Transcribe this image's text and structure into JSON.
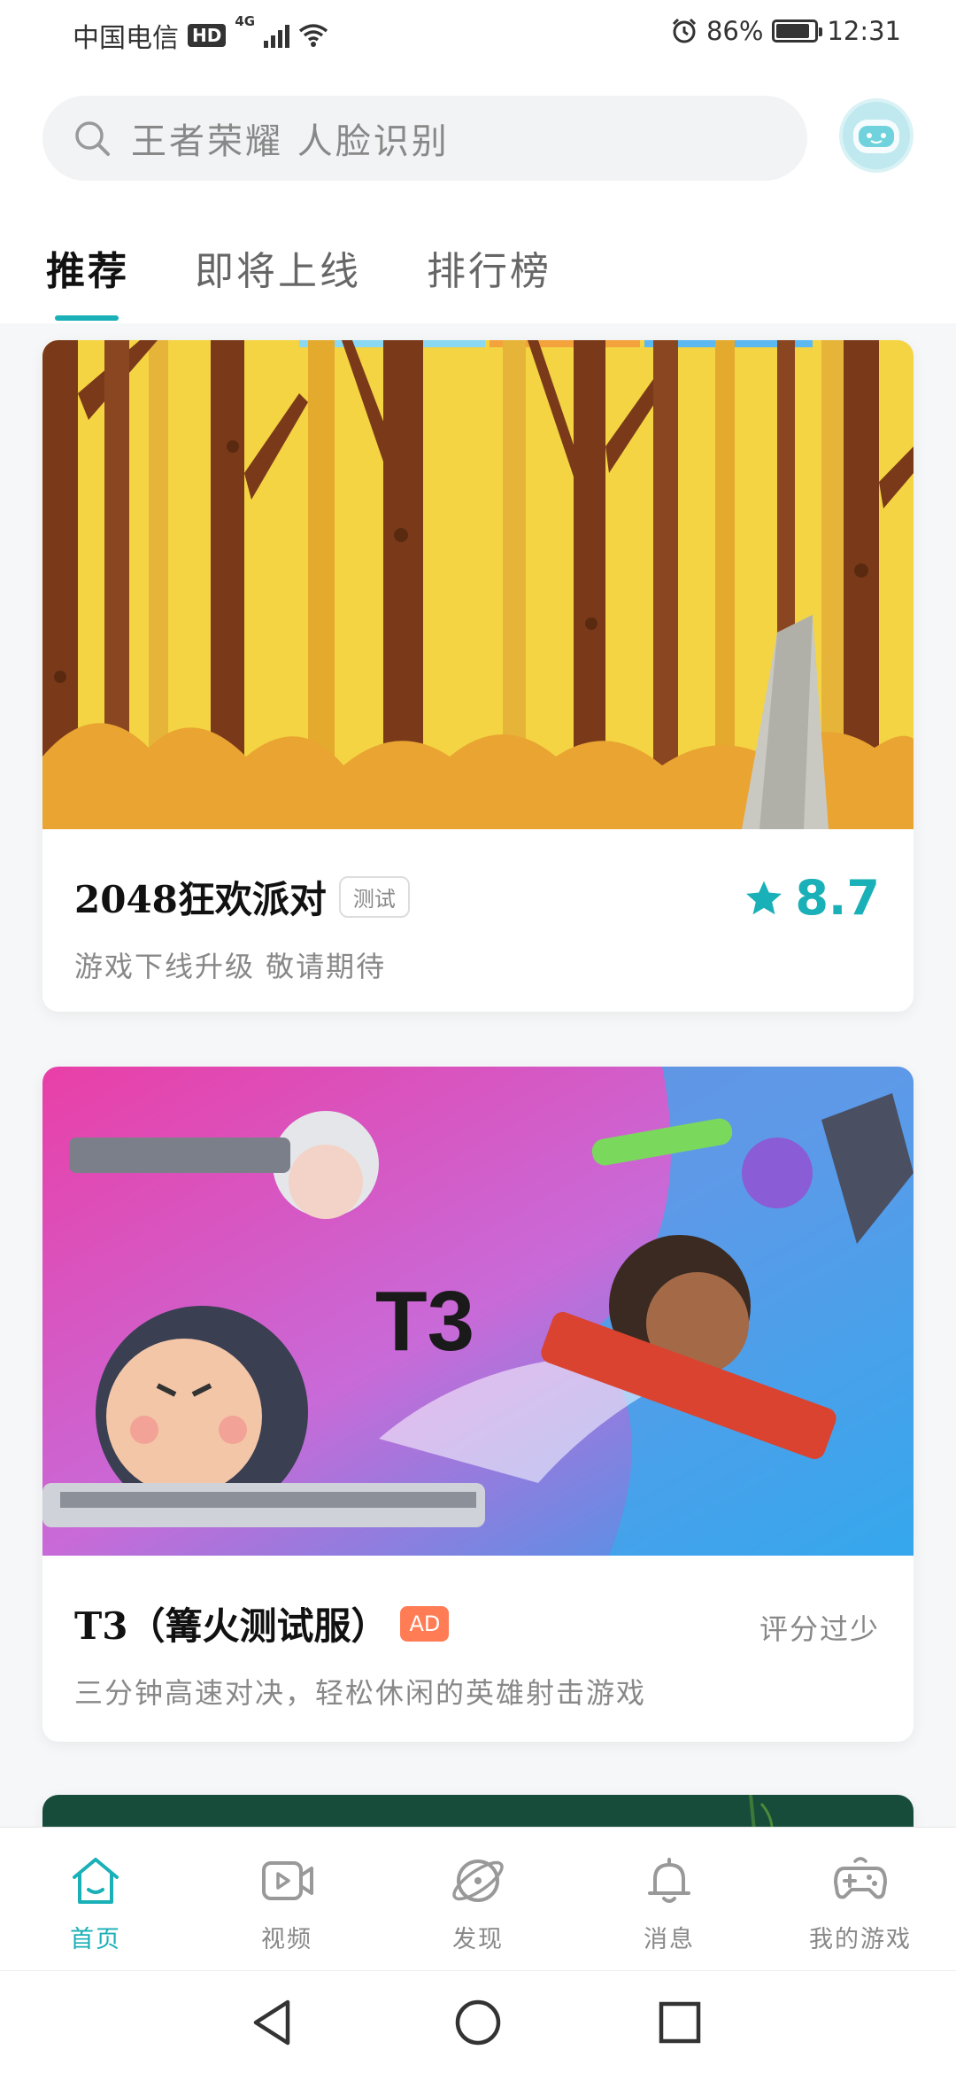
{
  "status_bar": {
    "carrier": "中国电信",
    "hd": "HD",
    "network": "4G",
    "battery_percent": "86%",
    "battery_level": 0.86,
    "time": "12:31"
  },
  "search": {
    "placeholder": "王者荣耀  人脸识别"
  },
  "tabs": [
    {
      "label": "推荐",
      "active": true
    },
    {
      "label": "即将上线",
      "active": false
    },
    {
      "label": "排行榜",
      "active": false
    }
  ],
  "cards": [
    {
      "title": "2048狂欢派对",
      "tag": "测试",
      "description": "游戏下线升级 敬请期待",
      "rating": "8.7"
    },
    {
      "title": "T3（篝火测试服）",
      "tag": "AD",
      "description": "三分钟高速对决，轻松休闲的英雄射击游戏",
      "rating_text": "评分过少",
      "banner_logo": "T3"
    }
  ],
  "bottom_nav": [
    {
      "label": "首页",
      "icon": "home-icon",
      "active": true
    },
    {
      "label": "视频",
      "icon": "video-icon",
      "active": false
    },
    {
      "label": "发现",
      "icon": "discover-planet-icon",
      "active": false
    },
    {
      "label": "消息",
      "icon": "bell-icon",
      "active": false
    },
    {
      "label": "我的游戏",
      "icon": "gamepad-icon",
      "active": false
    }
  ],
  "colors": {
    "accent": "#1ab0b7",
    "ad_tag": "#ff7c55"
  }
}
